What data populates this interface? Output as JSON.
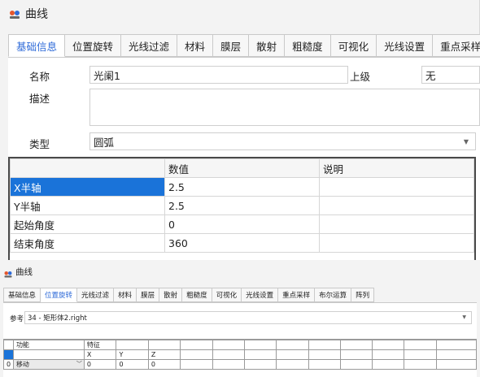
{
  "panel1": {
    "title": "曲线",
    "icon": "app-logo-icon",
    "tabs": [
      "基础信息",
      "位置旋转",
      "光线过滤",
      "材料",
      "膜层",
      "散射",
      "粗糙度",
      "可视化",
      "光线设置",
      "重点采样"
    ],
    "active_tab": 0,
    "form": {
      "name_label": "名称",
      "name_value": "光阑1",
      "parent_label": "上级",
      "parent_value": "无",
      "desc_label": "描述",
      "desc_value": "",
      "type_label": "类型",
      "type_value": "圆弧"
    },
    "table": {
      "headers": [
        "",
        "数值",
        "说明"
      ],
      "rows": [
        [
          "X半轴",
          "2.5",
          ""
        ],
        [
          "Y半轴",
          "2.5",
          ""
        ],
        [
          "起始角度",
          "0",
          ""
        ],
        [
          "结束角度",
          "360",
          ""
        ]
      ]
    }
  },
  "panel2": {
    "title": "曲线",
    "icon": "app-logo-icon",
    "tabs": [
      "基础信息",
      "位置旋转",
      "光线过滤",
      "材料",
      "膜层",
      "散射",
      "粗糙度",
      "可视化",
      "光线设置",
      "重点采样",
      "布尔运算",
      "阵列"
    ],
    "active_tab": 1,
    "form": {
      "ref_label": "参考",
      "ref_value": "34 - 矩形体2.right"
    },
    "table": {
      "header1": [
        "",
        "功能",
        "特征",
        "",
        ""
      ],
      "header2": [
        "",
        "",
        "X",
        "Y",
        "Z"
      ],
      "rows": [
        [
          "0",
          "移动",
          "0",
          "0",
          "0"
        ]
      ]
    }
  },
  "colors": {
    "accent": "#2f6bd8",
    "selection": "#1a73d9",
    "panel_bg": "#f3f3f3"
  }
}
